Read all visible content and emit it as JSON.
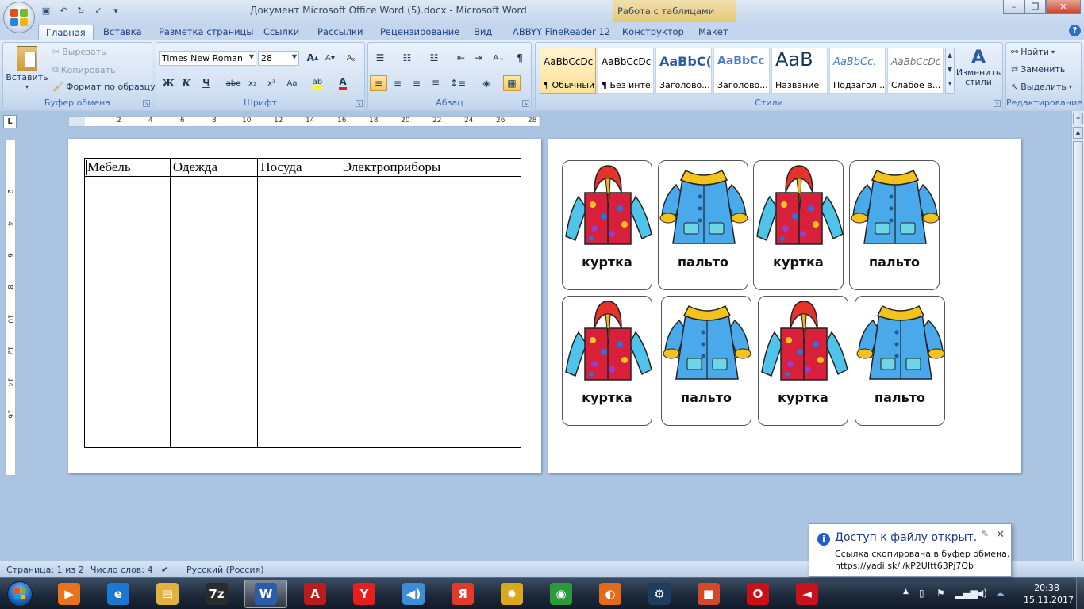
{
  "window": {
    "title": "Документ Microsoft Office Word (5).docx - Microsoft Word",
    "context_tab_group": "Работа с таблицами",
    "minimize": "–",
    "restore": "❐",
    "close": "✕"
  },
  "tabs": [
    "Главная",
    "Вставка",
    "Разметка страницы",
    "Ссылки",
    "Рассылки",
    "Рецензирование",
    "Вид",
    "ABBYY FineReader 12",
    "Конструктор",
    "Макет"
  ],
  "ribbon": {
    "clipboard": {
      "label": "Буфер обмена",
      "paste": "Вставить",
      "cut": "Вырезать",
      "copy": "Копировать",
      "format_painter": "Формат по образцу"
    },
    "font": {
      "label": "Шрифт",
      "font_name": "Times New Roman",
      "font_size": "28",
      "bold": "Ж",
      "italic": "К",
      "underline": "Ч",
      "strike": "abe",
      "subscript": "x₂",
      "superscript": "x²",
      "change_case": "Aa",
      "grow": "A",
      "shrink": "A"
    },
    "paragraph": {
      "label": "Абзац",
      "pilcrow": "¶"
    },
    "styles": {
      "label": "Стили",
      "items": [
        {
          "preview": "AaBbCcDc",
          "name": "¶ Обычный"
        },
        {
          "preview": "AaBbCcDc",
          "name": "¶ Без инте..."
        },
        {
          "preview": "AaBbC(",
          "name": "Заголово..."
        },
        {
          "preview": "AaBbCc",
          "name": "Заголово..."
        },
        {
          "preview": "AaB",
          "name": "Название"
        },
        {
          "preview": "AaBbCc.",
          "name": "Подзагол..."
        },
        {
          "preview": "AaBbCcDc",
          "name": "Слабое в..."
        }
      ],
      "change_styles": "Изменить стили"
    },
    "editing": {
      "label": "Редактирование",
      "find": "Найти",
      "replace": "Заменить",
      "select": "Выделить"
    }
  },
  "ruler": {
    "numbers": [
      "2",
      "4",
      "6",
      "8",
      "10",
      "12",
      "14",
      "16",
      "18",
      "20",
      "22",
      "24",
      "26",
      "28"
    ]
  },
  "vruler": {
    "numbers": [
      "2",
      "4",
      "6",
      "8",
      "10",
      "12",
      "14",
      "16"
    ]
  },
  "document": {
    "table_headers": [
      "Мебель",
      "Одежда",
      "Посуда",
      "Электроприборы"
    ]
  },
  "cards": [
    {
      "label": "куртка",
      "kind": "jacket"
    },
    {
      "label": "пальто",
      "kind": "coat"
    },
    {
      "label": "куртка",
      "kind": "jacket"
    },
    {
      "label": "пальто",
      "kind": "coat"
    },
    {
      "label": "куртка",
      "kind": "jacket"
    },
    {
      "label": "пальто",
      "kind": "coat"
    },
    {
      "label": "куртка",
      "kind": "jacket"
    },
    {
      "label": "пальто",
      "kind": "coat"
    }
  ],
  "status": {
    "page": "Страница: 1 из 2",
    "words": "Число слов: 4",
    "language": "Русский (Россия)"
  },
  "notification": {
    "title": "Доступ к файлу открыт.",
    "line1": "Ссылка скопирована в буфер обмена.",
    "line2": "https://yadi.sk/i/kP2UItt63Pj7Qb"
  },
  "taskbar": {
    "apps": [
      {
        "name": "media-player",
        "glyph": "▶",
        "color": "#e8731c"
      },
      {
        "name": "internet-explorer",
        "glyph": "e",
        "color": "#1a77d2"
      },
      {
        "name": "explorer",
        "glyph": "▤",
        "color": "#e2b23c"
      },
      {
        "name": "7zip",
        "glyph": "7z",
        "color": "#2b2b2b"
      },
      {
        "name": "word",
        "glyph": "W",
        "color": "#2a5caa"
      },
      {
        "name": "acrobat",
        "glyph": "A",
        "color": "#b81d1d"
      },
      {
        "name": "yandex",
        "glyph": "Y",
        "color": "#e61e1e"
      },
      {
        "name": "audio",
        "glyph": "◀)",
        "color": "#3a8fd8"
      },
      {
        "name": "yandex-browser",
        "glyph": "Я",
        "color": "#e23a2a"
      },
      {
        "name": "sunflower",
        "glyph": "✹",
        "color": "#d9a81e"
      },
      {
        "name": "chrome",
        "glyph": "◉",
        "color": "#2c9a3c"
      },
      {
        "name": "firefox",
        "glyph": "◐",
        "color": "#e46b1d"
      },
      {
        "name": "steam",
        "glyph": "⚙",
        "color": "#1c3d5e"
      },
      {
        "name": "screen-recorder",
        "glyph": "■",
        "color": "#d24a2a"
      },
      {
        "name": "opera",
        "glyph": "O",
        "color": "#cc0f16"
      },
      {
        "name": "red-app",
        "glyph": "◄",
        "color": "#c8121b"
      }
    ],
    "clock_time": "20:38",
    "clock_date": "15.11.2017"
  },
  "colors": {
    "accent": "#15428b",
    "ribbon": "#c5d6ec",
    "taskbar": "#1b2738"
  }
}
